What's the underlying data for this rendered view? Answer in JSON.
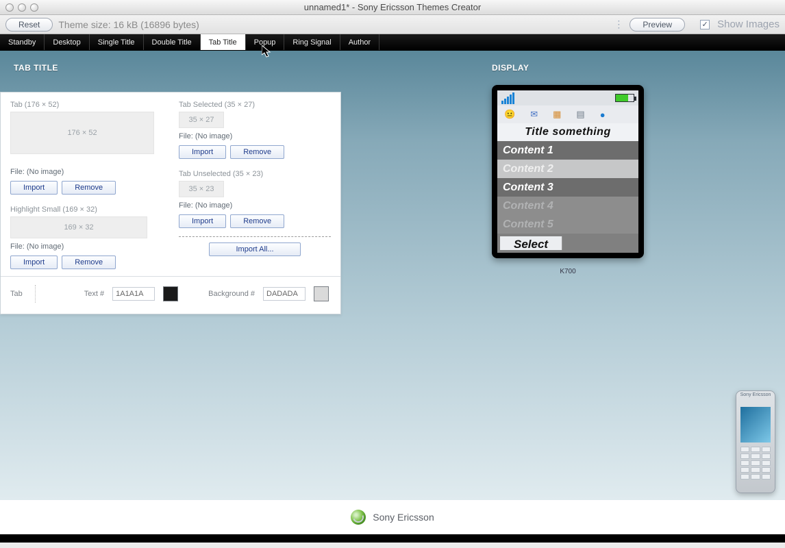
{
  "window": {
    "title": "unnamed1* - Sony Ericsson Themes Creator"
  },
  "toolbar": {
    "reset": "Reset",
    "theme_size": "Theme size: 16 kB (16896 bytes)",
    "preview": "Preview",
    "show_images": "Show Images"
  },
  "tabs": [
    "Standby",
    "Desktop",
    "Single Title",
    "Double Title",
    "Tab Title",
    "Popup",
    "Ring Signal",
    "Author"
  ],
  "active_tab_index": 4,
  "section_left_title": "TAB TITLE",
  "section_right_title": "DISPLAY",
  "panel": {
    "tab_label": "Tab (176 × 52)",
    "tab_box": "176 × 52",
    "highlight_label": "Highlight Small (169 × 32)",
    "highlight_box": "169 × 32",
    "tab_selected_label": "Tab Selected (35 × 27)",
    "tab_selected_box": "35 × 27",
    "tab_unselected_label": "Tab Unselected (35 × 23)",
    "tab_unselected_box": "35 × 23",
    "file_noimage": "File: (No image)",
    "import": "Import",
    "remove": "Remove",
    "import_all": "Import All..."
  },
  "footer": {
    "tab": "Tab",
    "text_label": "Text #",
    "text_hex": "1A1A1A",
    "bg_label": "Background #",
    "bg_hex": "DADADA",
    "text_color": "#1A1A1A",
    "bg_color": "#DADADA"
  },
  "preview": {
    "title": "Title something",
    "contents": [
      "Content 1",
      "Content 2",
      "Content 3",
      "Content 4",
      "Content 5"
    ],
    "select": "Select",
    "model": "K700"
  },
  "brand": "Sony Ericsson"
}
